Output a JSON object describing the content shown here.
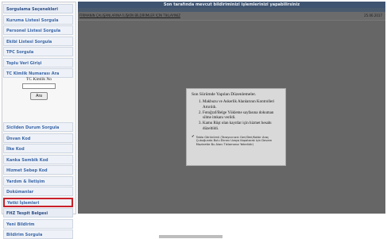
{
  "sidebar": {
    "items_top": [
      {
        "label": "Sorgulama Seçenekleri",
        "header": true
      },
      {
        "label": "Kuruma Listesi Sorgula"
      },
      {
        "label": "Personel Listesi Sorgula"
      },
      {
        "label": "Ekibi Listesi Sorgula"
      },
      {
        "label": "TPC Sorgula"
      },
      {
        "label": "Toplu Veri Girişi"
      },
      {
        "label": "TC Kimlik Numarası Ara"
      }
    ],
    "tc_search": {
      "label": "TC Kimlik No",
      "input_value": "",
      "button_label": "Ara"
    },
    "items_bottom": [
      {
        "label": "Sicilden Durum Sorgula"
      },
      {
        "label": "Ünvan Kod"
      },
      {
        "label": "İlke Kod"
      },
      {
        "label": "Kanka Sembik Kod"
      },
      {
        "label": "Hizmet Sebep Kod"
      },
      {
        "label": "Yardım & İletişim"
      },
      {
        "label": "Dokümanlar"
      },
      {
        "label": "Yetki İşlemleri",
        "highlighted": true
      },
      {
        "label": "FHZ Tespit Belgesi",
        "header": true
      },
      {
        "label": "Yeni Bildirim"
      },
      {
        "label": "Bildirim Sorgula"
      }
    ]
  },
  "main": {
    "title": "Son tarafında mevcut bildiriminizi işlemlerinizi yapabilirsiniz",
    "row": {
      "text": "FİRMANIN ÇALIŞANLARINA İLİŞKİN BİLDİRİMLER İÇİN TIKLAYINIZ",
      "date": "25.06.2017"
    }
  },
  "dialog": {
    "title": "Son Sürümde Yapılan Düzenlemeler.",
    "items": [
      "Makbuzu ve Askerlik Alanlarının Kontrolleri Artırıldı.",
      "Fotoğraf/Belge Yükleme sayfasına dokuman silme imkanı verildi.",
      "Kamu Rüşt olan kayıtlar için hizmet hesabı düzeltildi."
    ],
    "note": "Tablo Görünümü (Tarayıcınızın Geri/İleri/Kaldır Araç Çubuğunda Bulu Ekranı Uzaya Kapatarak için Devam Mazinette Bu Alanı Tıklamanız Yeterlidir)"
  }
}
